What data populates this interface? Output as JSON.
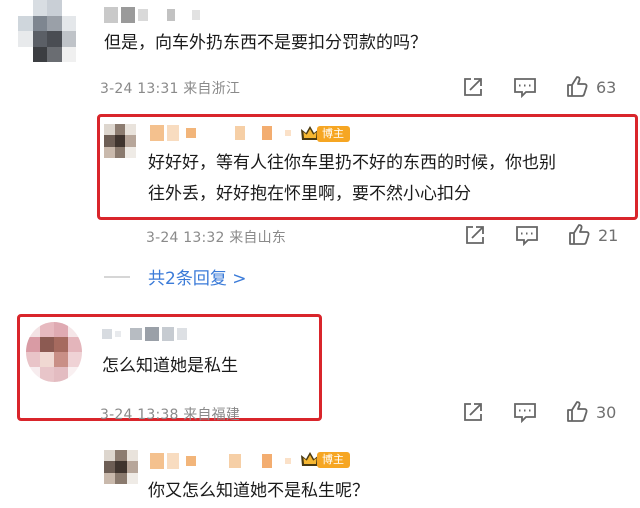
{
  "comments": [
    {
      "text": "但是，向车外扔东西不是要扣分罚款的吗？",
      "meta": "3-24 13:31 来自浙江",
      "likes": "63"
    },
    {
      "badge": "博主",
      "text_line1": "好好好，等有人往你车里扔不好的东西的时候，你也别",
      "text_line2": "往外丢，好好抱在怀里啊，要不然小心扣分",
      "meta": "3-24 13:32 来自山东",
      "likes": "21"
    },
    {
      "replies_link": "共2条回复 >"
    },
    {
      "text": "怎么知道她是私生",
      "meta": "3-24 13:38 来自福建",
      "likes": "30"
    },
    {
      "badge": "博主",
      "text": "你又怎么知道她不是私生呢？"
    }
  ],
  "icons": {
    "share": "share-icon",
    "comment": "comment-icon",
    "like": "thumbs-up-icon"
  },
  "colors": {
    "highlight_border": "#d9252b",
    "link": "#3b7bd8",
    "badge": "#f6a623"
  }
}
